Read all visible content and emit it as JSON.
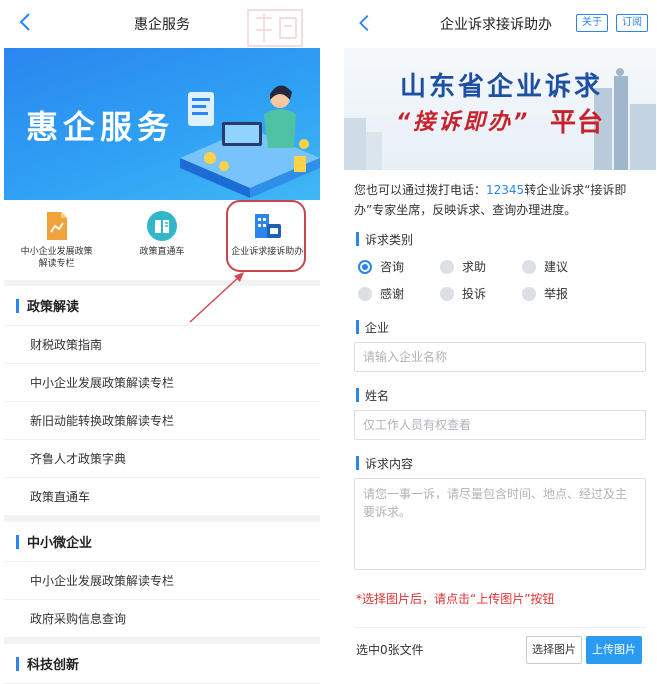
{
  "left": {
    "nav_title": "惠企服务",
    "banner_title": "惠企服务",
    "quick": [
      {
        "label": "中小企业发展政策解读专栏",
        "icon": "chart-doc-icon"
      },
      {
        "label": "政策直通车",
        "icon": "book-icon"
      },
      {
        "label": "企业诉求接诉助办",
        "icon": "building-icon"
      }
    ],
    "sections": [
      {
        "title": "政策解读",
        "items": [
          "财税政策指南",
          "中小企业发展政策解读专栏",
          "新旧动能转换政策解读专栏",
          "齐鲁人才政策字典",
          "政策直通车"
        ]
      },
      {
        "title": "中小微企业",
        "items": [
          "中小企业发展政策解读专栏",
          "政府采购信息查询"
        ]
      },
      {
        "title": "科技创新",
        "items": []
      }
    ]
  },
  "right": {
    "nav_title": "企业诉求接诉助办",
    "pill_about": "关于",
    "pill_subscribe": "订阅",
    "banner_line1": "山东省企业诉求",
    "banner_line2": "“接诉即办”",
    "banner_line2b": "平台",
    "info_prefix": "您也可以通过拨打电话：",
    "info_phone": "12345",
    "info_suffix": "转企业诉求“接诉即办”专家坐席，反映诉求、查询办理进度。",
    "category_label": "诉求类别",
    "categories": [
      "咨询",
      "求助",
      "建议",
      "感谢",
      "投诉",
      "举报"
    ],
    "selected_category": "咨询",
    "company_label": "企业",
    "company_placeholder": "请输入企业名称",
    "name_label": "姓名",
    "name_placeholder": "仅工作人员有权查看",
    "content_label": "诉求内容",
    "content_placeholder": "请您一事一诉，请尽量包含时间、地点、经过及主要诉求。",
    "warning": "*选择图片后，请点击“上传图片”按钮",
    "file_count": "选中0张文件",
    "select_button": "选择图片",
    "upload_button": "上传图片"
  },
  "colors": {
    "accent": "#2a86ee",
    "highlight": "#c9454f",
    "warning": "#d33333"
  }
}
